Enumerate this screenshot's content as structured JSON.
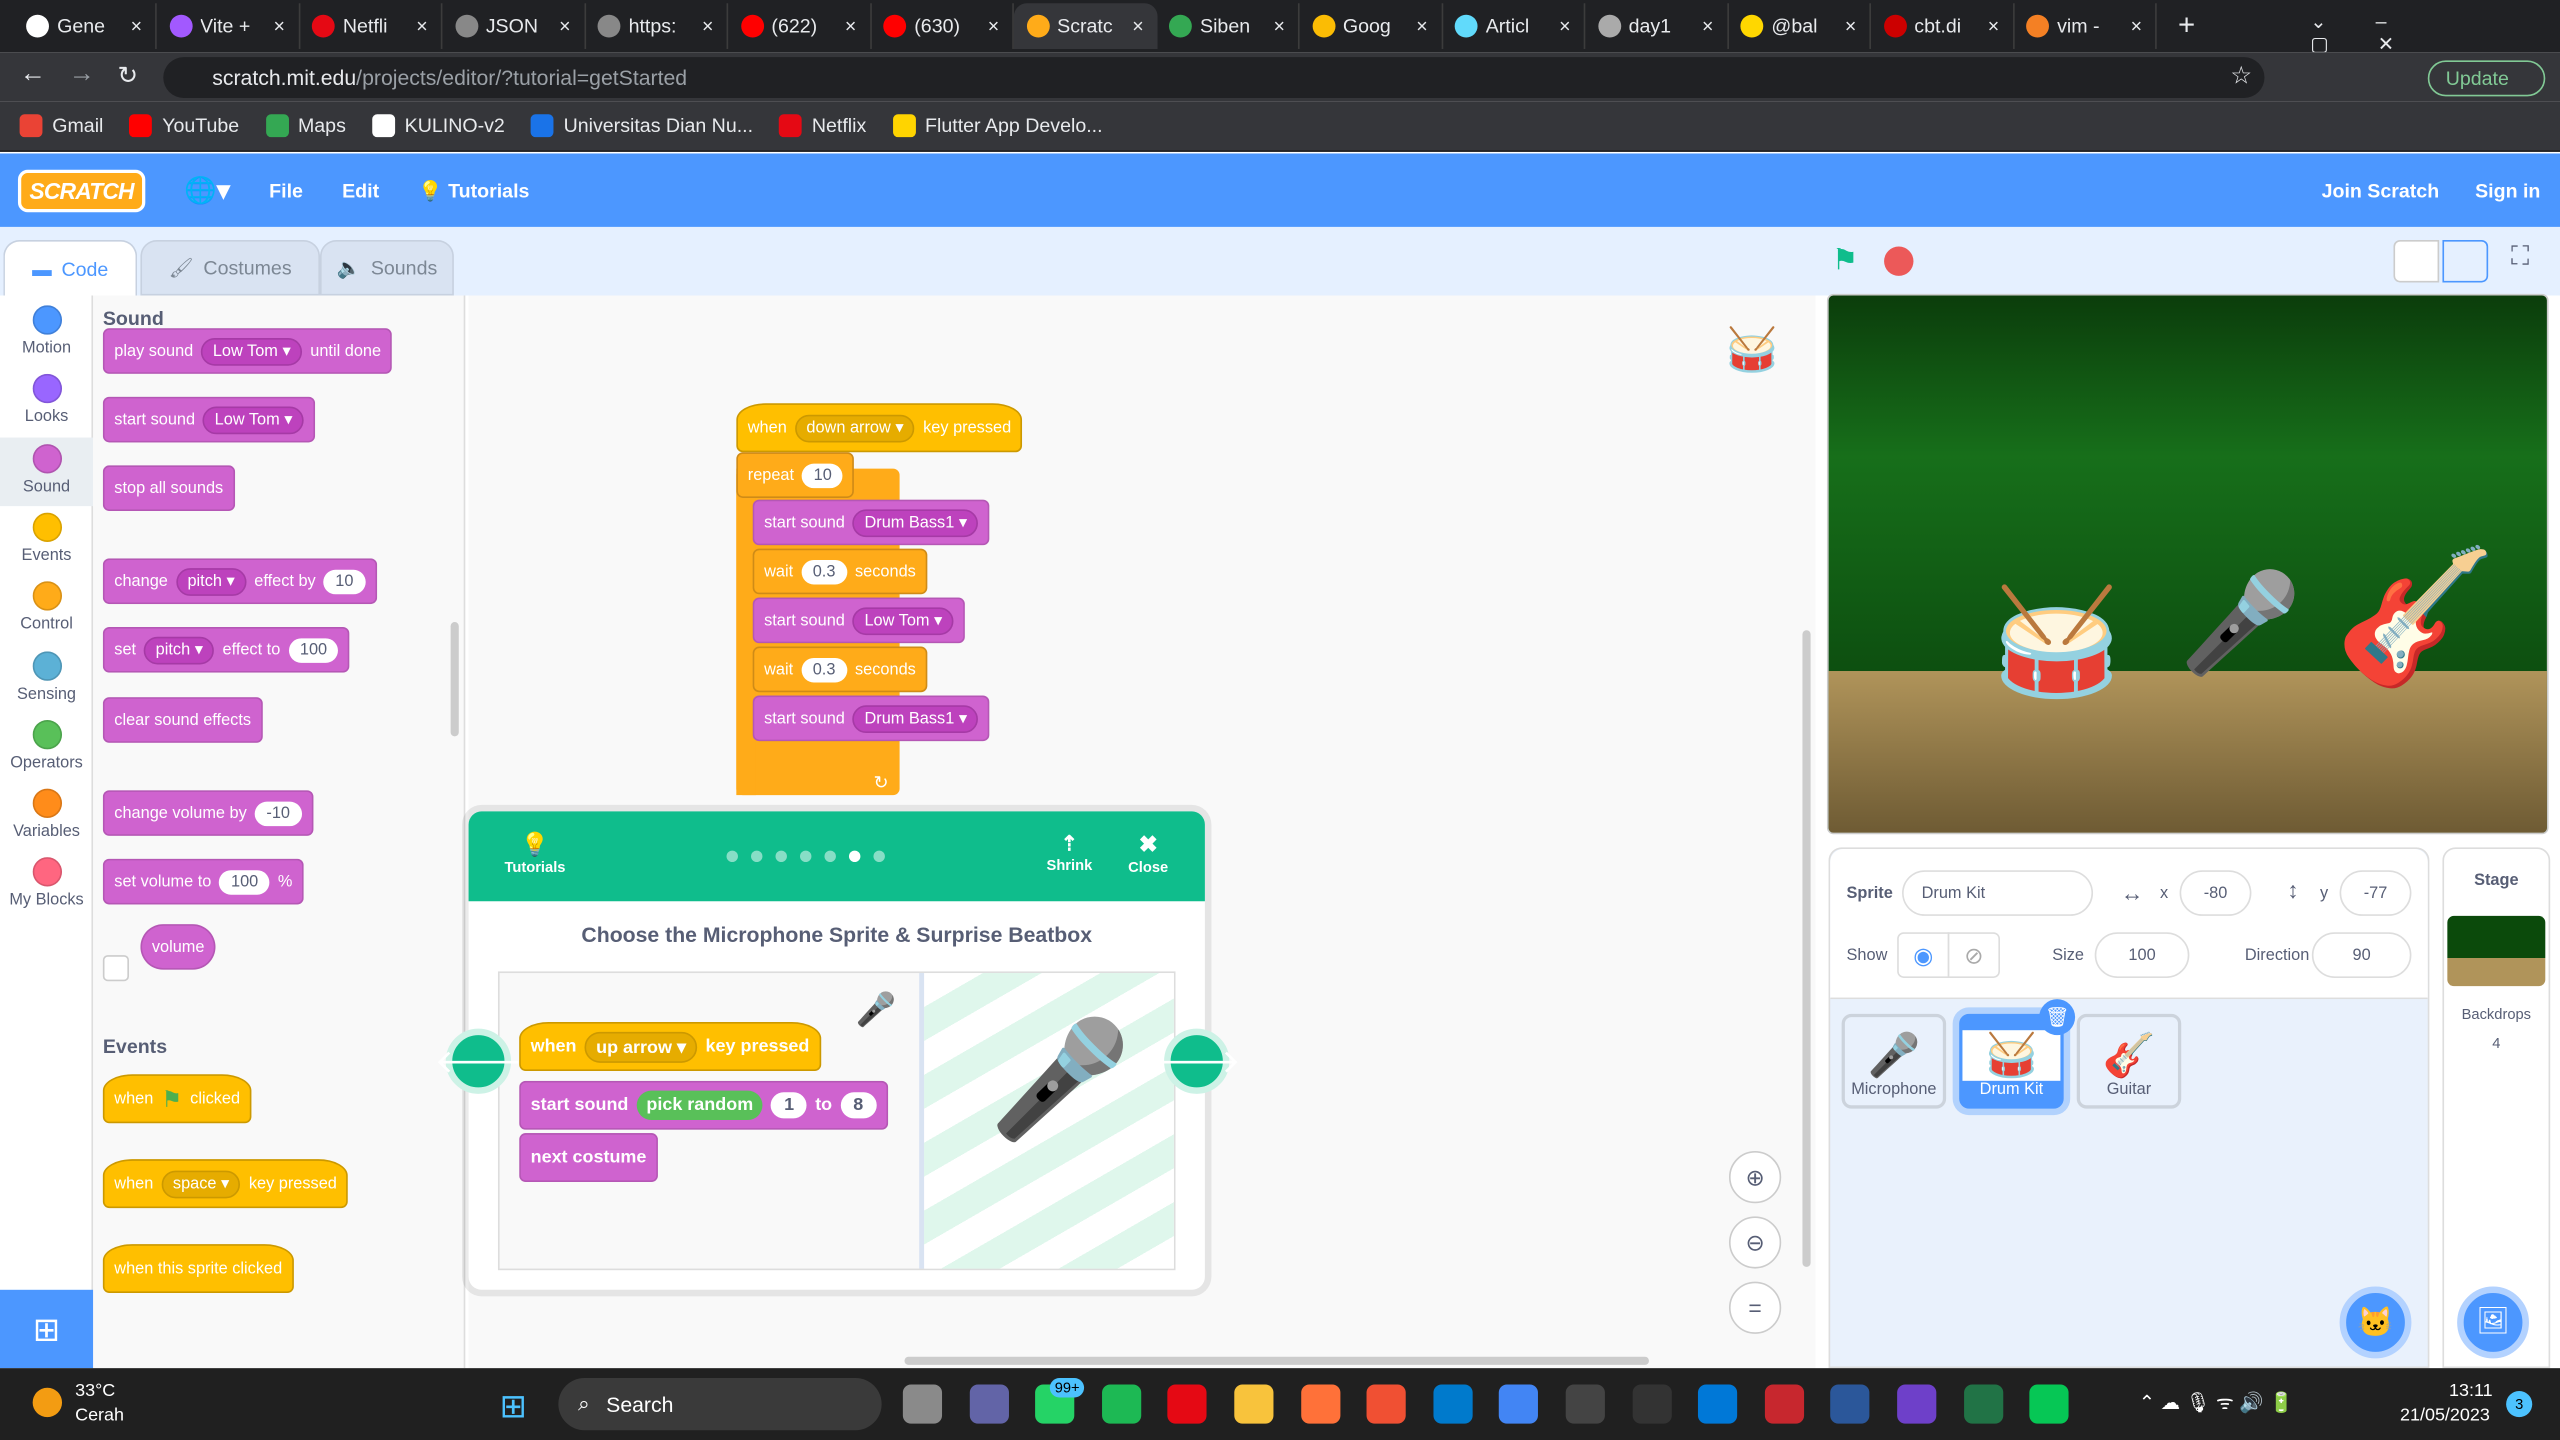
{
  "browser": {
    "tabs": [
      {
        "title": "Gene",
        "color": "#ffffff"
      },
      {
        "title": "Vite +",
        "color": "#a259ff"
      },
      {
        "title": "Netfli",
        "color": "#e50914"
      },
      {
        "title": "JSON",
        "color": "#888888"
      },
      {
        "title": "https:",
        "color": "#888888"
      },
      {
        "title": "(622)",
        "color": "#ff0000"
      },
      {
        "title": "(630)",
        "color": "#ff0000"
      },
      {
        "title": "Scratc",
        "color": "#ffab19",
        "active": true
      },
      {
        "title": "Siben",
        "color": "#34a853"
      },
      {
        "title": "Goog",
        "color": "#fbbc04"
      },
      {
        "title": "Articl",
        "color": "#61dafb"
      },
      {
        "title": "day1",
        "color": "#aaaaaa"
      },
      {
        "title": "@bal",
        "color": "#ffd700"
      },
      {
        "title": "cbt.di",
        "color": "#cc0000"
      },
      {
        "title": "vim -",
        "color": "#f48024"
      }
    ],
    "url_host": "scratch.mit.edu",
    "url_path": "/projects/editor/?tutorial=getStarted",
    "update_label": "Update",
    "bookmarks": [
      {
        "label": "Gmail",
        "color": "#ea4335"
      },
      {
        "label": "YouTube",
        "color": "#ff0000"
      },
      {
        "label": "Maps",
        "color": "#34a853"
      },
      {
        "label": "KULINO-v2",
        "color": "#ffffff"
      },
      {
        "label": "Universitas Dian Nu...",
        "color": "#1a73e8"
      },
      {
        "label": "Netflix",
        "color": "#e50914"
      },
      {
        "label": "Flutter App Develo...",
        "color": "#ffd400"
      }
    ]
  },
  "menubar": {
    "logo": "SCRATCH",
    "file": "File",
    "edit": "Edit",
    "tutorials": "Tutorials",
    "join": "Join Scratch",
    "signin": "Sign in"
  },
  "tabs": {
    "code": "Code",
    "costumes": "Costumes",
    "sounds": "Sounds"
  },
  "categories": [
    {
      "label": "Motion",
      "color": "#4c97ff"
    },
    {
      "label": "Looks",
      "color": "#9966ff"
    },
    {
      "label": "Sound",
      "color": "#cf63cf"
    },
    {
      "label": "Events",
      "color": "#ffbf00"
    },
    {
      "label": "Control",
      "color": "#ffab19"
    },
    {
      "label": "Sensing",
      "color": "#5cb1d6"
    },
    {
      "label": "Operators",
      "color": "#59c059"
    },
    {
      "label": "Variables",
      "color": "#ff8c1a"
    },
    {
      "label": "My Blocks",
      "color": "#ff6680"
    }
  ],
  "palette": {
    "sound_header": "Sound",
    "events_header": "Events",
    "blocks": [
      {
        "cls": "snd",
        "parts": [
          [
            "t",
            "play sound"
          ],
          [
            "d",
            "Low Tom"
          ],
          [
            "t",
            "until done"
          ]
        ]
      },
      {
        "cls": "snd",
        "parts": [
          [
            "t",
            "start sound"
          ],
          [
            "d",
            "Low Tom"
          ]
        ]
      },
      {
        "cls": "snd",
        "parts": [
          [
            "t",
            "stop all sounds"
          ]
        ]
      },
      {
        "cls": "snd",
        "parts": [
          [
            "t",
            "change"
          ],
          [
            "d",
            "pitch"
          ],
          [
            "t",
            "effect by"
          ],
          [
            "n",
            "10"
          ]
        ]
      },
      {
        "cls": "snd",
        "parts": [
          [
            "t",
            "set"
          ],
          [
            "d",
            "pitch"
          ],
          [
            "t",
            "effect to"
          ],
          [
            "n",
            "100"
          ]
        ]
      },
      {
        "cls": "snd",
        "parts": [
          [
            "t",
            "clear sound effects"
          ]
        ]
      },
      {
        "cls": "snd",
        "parts": [
          [
            "t",
            "change volume by"
          ],
          [
            "n",
            "-10"
          ]
        ]
      },
      {
        "cls": "snd",
        "parts": [
          [
            "t",
            "set volume to"
          ],
          [
            "n",
            "100"
          ],
          [
            "t",
            "%"
          ]
        ]
      },
      {
        "cls": "snd",
        "parts": [
          [
            "t",
            "volume"
          ]
        ]
      },
      {
        "cls": "evt hat",
        "parts": [
          [
            "t",
            "when"
          ],
          [
            "f",
            ""
          ],
          [
            "t",
            "clicked"
          ]
        ]
      },
      {
        "cls": "evt hat",
        "parts": [
          [
            "t",
            "when"
          ],
          [
            "d",
            "space"
          ],
          [
            "t",
            "key pressed"
          ]
        ]
      },
      {
        "cls": "evt hat",
        "parts": [
          [
            "t",
            "when this sprite clicked"
          ]
        ]
      }
    ]
  },
  "script": {
    "blocks": [
      {
        "cls": "evt hat",
        "parts": [
          [
            "t",
            "when"
          ],
          [
            "d",
            "down arrow"
          ],
          [
            "t",
            "key pressed"
          ]
        ]
      },
      {
        "cls": "ctl",
        "parts": [
          [
            "t",
            "repeat"
          ],
          [
            "n",
            "10"
          ]
        ]
      },
      {
        "cls": "snd",
        "parts": [
          [
            "t",
            "start sound"
          ],
          [
            "d",
            "Drum Bass1"
          ]
        ]
      },
      {
        "cls": "ctl",
        "parts": [
          [
            "t",
            "wait"
          ],
          [
            "n",
            "0.3"
          ],
          [
            "t",
            "seconds"
          ]
        ]
      },
      {
        "cls": "snd",
        "parts": [
          [
            "t",
            "start sound"
          ],
          [
            "d",
            "Low Tom"
          ]
        ]
      },
      {
        "cls": "ctl",
        "parts": [
          [
            "t",
            "wait"
          ],
          [
            "n",
            "0.3"
          ],
          [
            "t",
            "seconds"
          ]
        ]
      },
      {
        "cls": "snd",
        "parts": [
          [
            "t",
            "start sound"
          ],
          [
            "d",
            "Drum Bass1"
          ]
        ]
      }
    ]
  },
  "tutorial": {
    "label": "Tutorials",
    "shrink": "Shrink",
    "close": "Close",
    "step": 6,
    "steps": 7,
    "title": "Choose the Microphone Sprite & Surprise Beatbox",
    "blocks": [
      {
        "cls": "evt hat",
        "parts": [
          [
            "t",
            "when"
          ],
          [
            "d",
            "up arrow"
          ],
          [
            "t",
            "key pressed"
          ]
        ]
      },
      {
        "cls": "snd",
        "parts": [
          [
            "t",
            "start sound"
          ],
          [
            "r",
            "pick random"
          ],
          [
            "n",
            "1"
          ],
          [
            "t",
            "to"
          ],
          [
            "n",
            "8"
          ]
        ]
      },
      {
        "cls": "snd",
        "parts": [
          [
            "t",
            "next costume"
          ]
        ]
      }
    ]
  },
  "sprite_info": {
    "sprite_label": "Sprite",
    "name": "Drum Kit",
    "x_label": "x",
    "x": "-80",
    "y_label": "y",
    "y": "-77",
    "show_label": "Show",
    "size_label": "Size",
    "size": "100",
    "direction_label": "Direction",
    "direction": "90"
  },
  "sprites": [
    {
      "name": "Microphone"
    },
    {
      "name": "Drum Kit",
      "selected": true
    },
    {
      "name": "Guitar"
    }
  ],
  "stage_panel": {
    "title": "Stage",
    "backdrops_label": "Backdrops",
    "backdrops": "4"
  },
  "taskbar": {
    "temp": "33°C",
    "weather": "Cerah",
    "search": "Search",
    "badge": "99+",
    "time": "13:11",
    "date": "21/05/2023",
    "notif": "3",
    "apps": [
      "#8a8a8a",
      "#6264a7",
      "#25d366",
      "#1db954",
      "#e50914",
      "#f8c33c",
      "#ff7139",
      "#f05033",
      "#007acc",
      "#4285f4",
      "#444444",
      "#333333",
      "#0078d7",
      "#c7272e",
      "#2b579a",
      "#6e40c9",
      "#217346",
      "#06c755"
    ]
  }
}
